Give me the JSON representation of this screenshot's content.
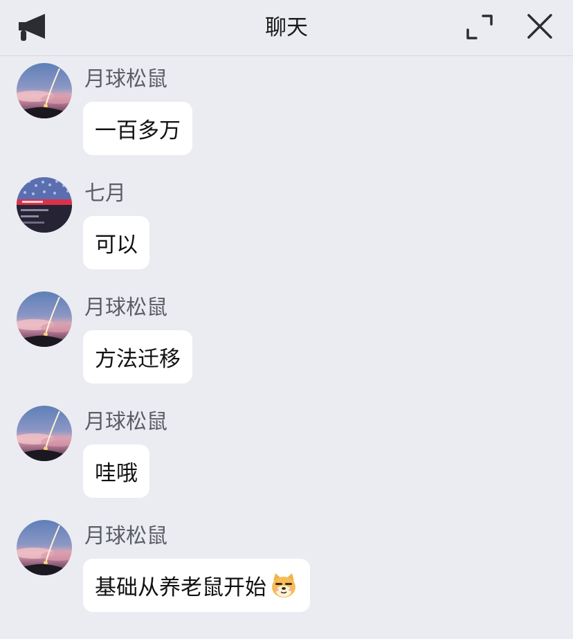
{
  "header": {
    "title": "聊天",
    "left_icon": "megaphone-icon",
    "right_icons": [
      "expand-icon",
      "close-icon"
    ]
  },
  "messages": [
    {
      "sender": "月球松鼠",
      "text": "一百多万",
      "avatar": "rocket-launch-avatar"
    },
    {
      "sender": "七月",
      "text": "可以",
      "avatar": "stadium-screenshot-avatar"
    },
    {
      "sender": "月球松鼠",
      "text": "方法迁移",
      "avatar": "rocket-launch-avatar"
    },
    {
      "sender": "月球松鼠",
      "text": "哇哦",
      "avatar": "rocket-launch-avatar"
    },
    {
      "sender": "月球松鼠",
      "text": "基础从养老鼠开始",
      "avatar": "rocket-launch-avatar",
      "emoji": "doge-emoji"
    }
  ],
  "colors": {
    "background": "#ebecf1",
    "bubble": "#ffffff",
    "sender_text": "#5c5e66",
    "message_text": "#111111"
  }
}
